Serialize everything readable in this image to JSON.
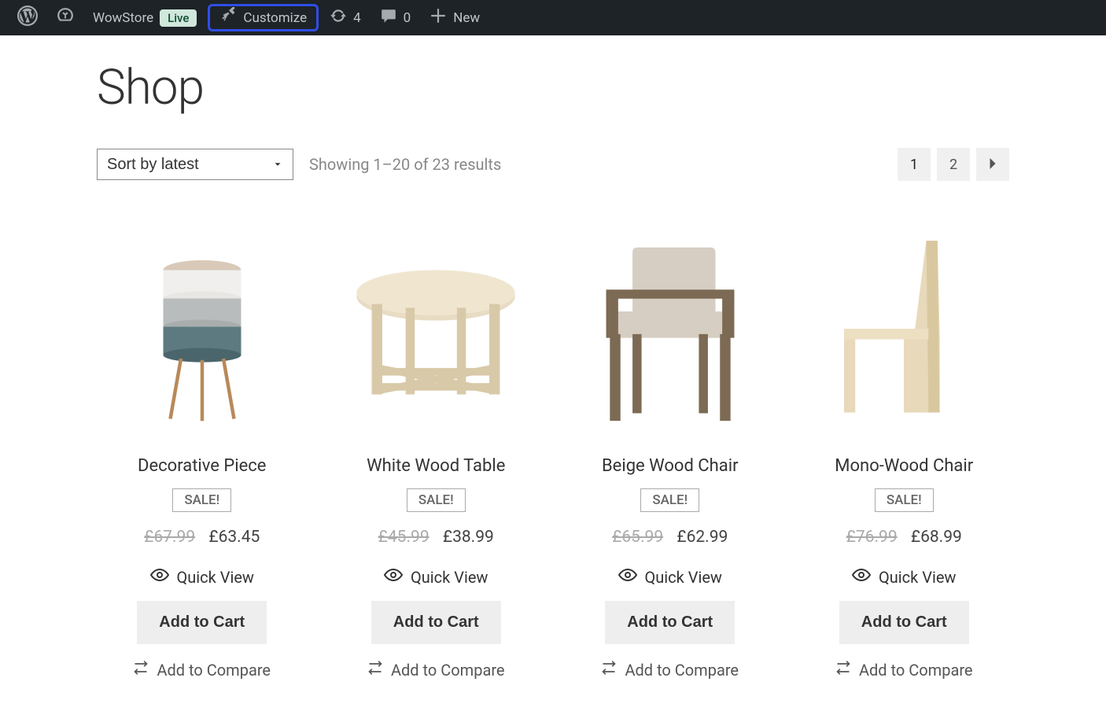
{
  "adminbar": {
    "site_name": "WowStore",
    "live_label": "Live",
    "customize_label": "Customize",
    "updates_count": "4",
    "comments_count": "0",
    "new_label": "New"
  },
  "page": {
    "title": "Shop",
    "sort_label": "Sort by latest",
    "results_text": "Showing 1–20 of 23 results"
  },
  "pagination": {
    "pages": [
      "1",
      "2"
    ],
    "current": "1"
  },
  "products": [
    {
      "title": "Decorative Piece",
      "sale": "SALE!",
      "old_price": "£67.99",
      "new_price": "£63.45",
      "quickview": "Quick View",
      "add": "Add to Cart",
      "compare": "Add to Compare"
    },
    {
      "title": "White Wood Table",
      "sale": "SALE!",
      "old_price": "£45.99",
      "new_price": "£38.99",
      "quickview": "Quick View",
      "add": "Add to Cart",
      "compare": "Add to Compare"
    },
    {
      "title": "Beige Wood Chair",
      "sale": "SALE!",
      "old_price": "£65.99",
      "new_price": "£62.99",
      "quickview": "Quick View",
      "add": "Add to Cart",
      "compare": "Add to Compare"
    },
    {
      "title": "Mono-Wood Chair",
      "sale": "SALE!",
      "old_price": "£76.99",
      "new_price": "£68.99",
      "quickview": "Quick View",
      "add": "Add to Cart",
      "compare": "Add to Compare"
    }
  ]
}
